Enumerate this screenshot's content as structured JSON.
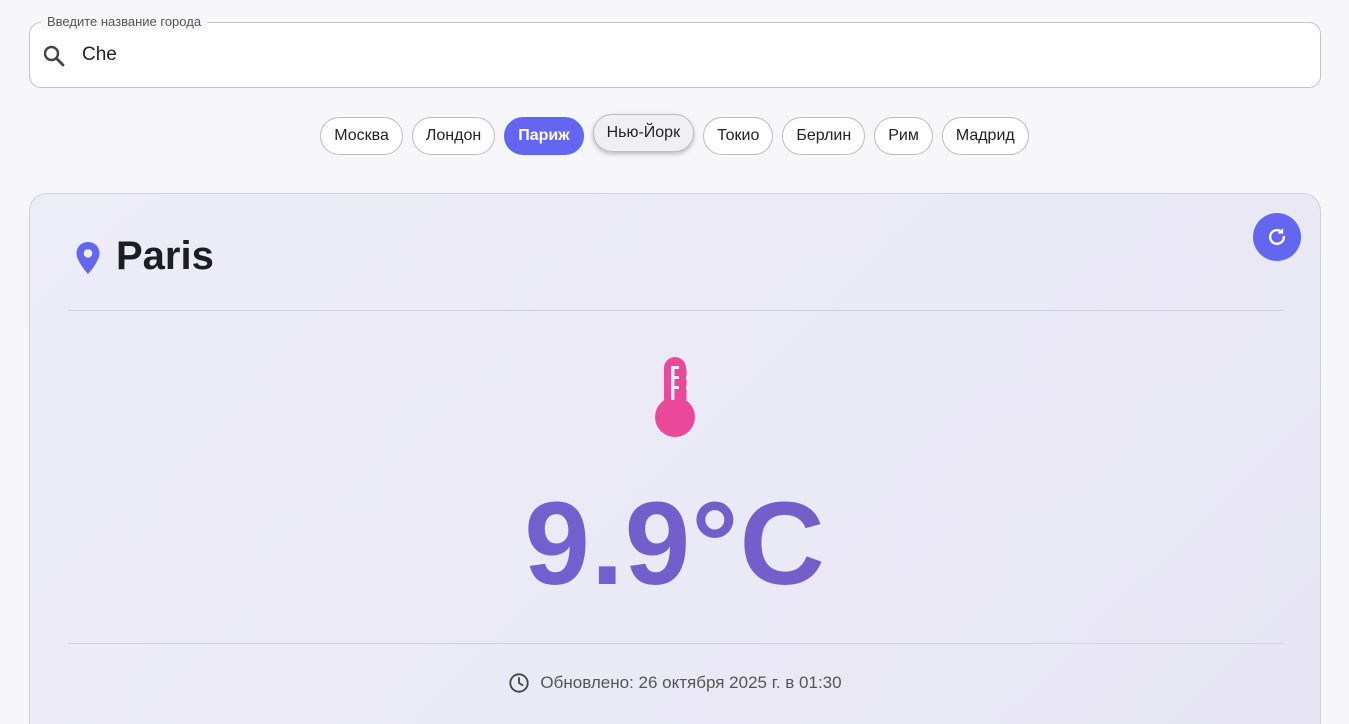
{
  "search": {
    "label": "Введите название города",
    "value": "Che",
    "icon": "search-icon"
  },
  "chips": [
    {
      "label": "Москва",
      "state": "default"
    },
    {
      "label": "Лондон",
      "state": "default"
    },
    {
      "label": "Париж",
      "state": "active"
    },
    {
      "label": "Нью-Йорк",
      "state": "hover"
    },
    {
      "label": "Токио",
      "state": "default"
    },
    {
      "label": "Берлин",
      "state": "default"
    },
    {
      "label": "Рим",
      "state": "default"
    },
    {
      "label": "Мадрид",
      "state": "default"
    }
  ],
  "weather": {
    "city": "Paris",
    "temperature": "9.9°C",
    "updated": "Обновлено: 26 октября 2025 г. в 01:30"
  },
  "colors": {
    "accent": "#6366f1",
    "thermometer": "#ec4899",
    "temperature_text": "#6a5fcf"
  },
  "icons": {
    "pin": "location-pin-icon",
    "refresh": "refresh-icon",
    "thermometer": "thermometer-icon",
    "clock": "clock-icon"
  }
}
